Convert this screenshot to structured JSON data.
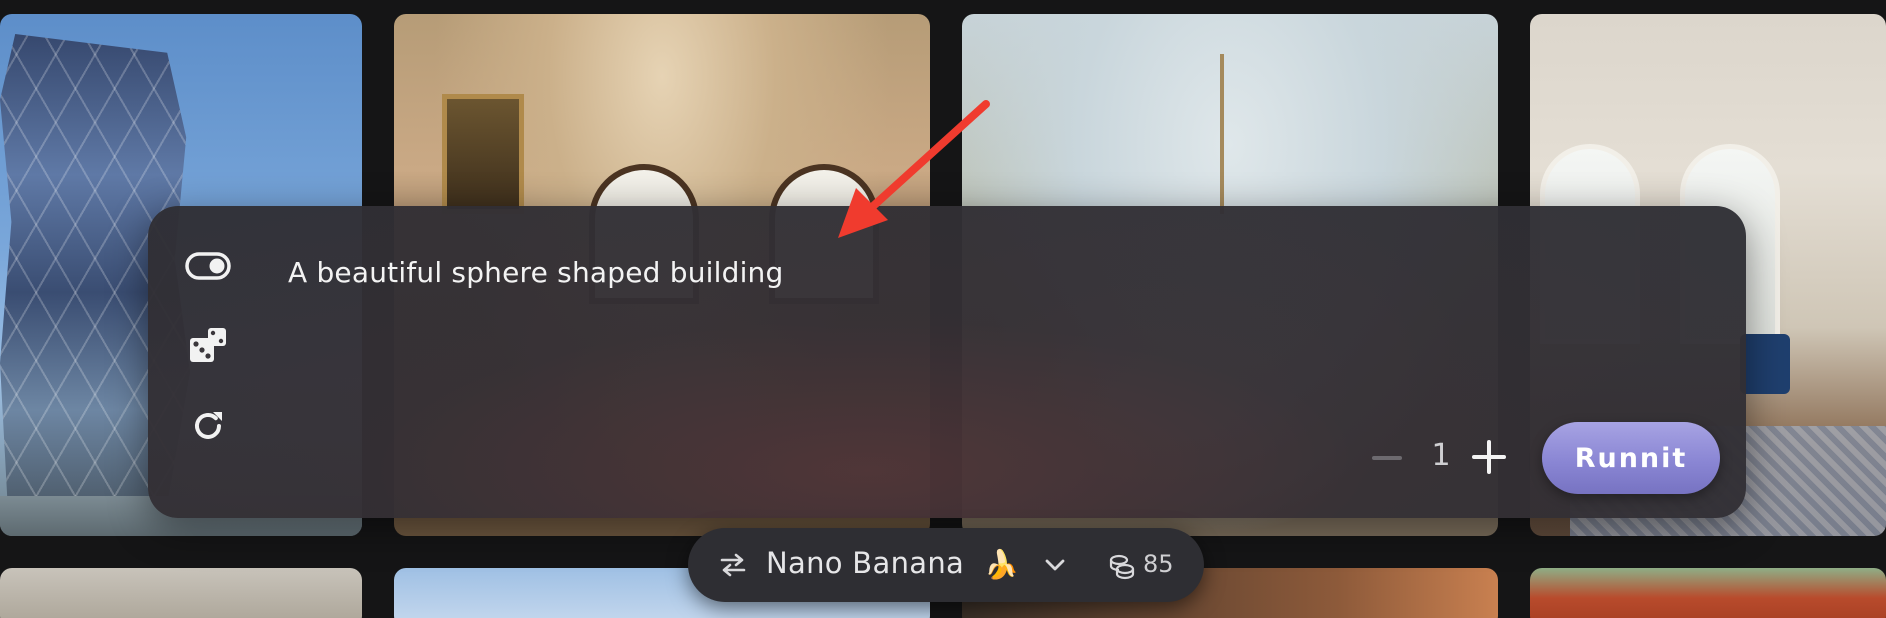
{
  "gallery": {
    "tiles": [
      {
        "subject": "glass tower"
      },
      {
        "subject": "ornate ceiling room"
      },
      {
        "subject": "pale blue ceiling room"
      },
      {
        "subject": "classic salon"
      }
    ]
  },
  "prompt_panel": {
    "prompt_text": "A beautiful sphere shaped building",
    "side_icons": [
      "toggle-icon",
      "dice-icon",
      "refresh-icon"
    ],
    "quantity": "1",
    "run_label": "Runnit",
    "run_color": "#8a86d4"
  },
  "model_bar": {
    "model_name": "Nano Banana",
    "model_emoji": "🍌",
    "credits": "85"
  },
  "annotation": {
    "arrow_color": "#f03b2e"
  }
}
